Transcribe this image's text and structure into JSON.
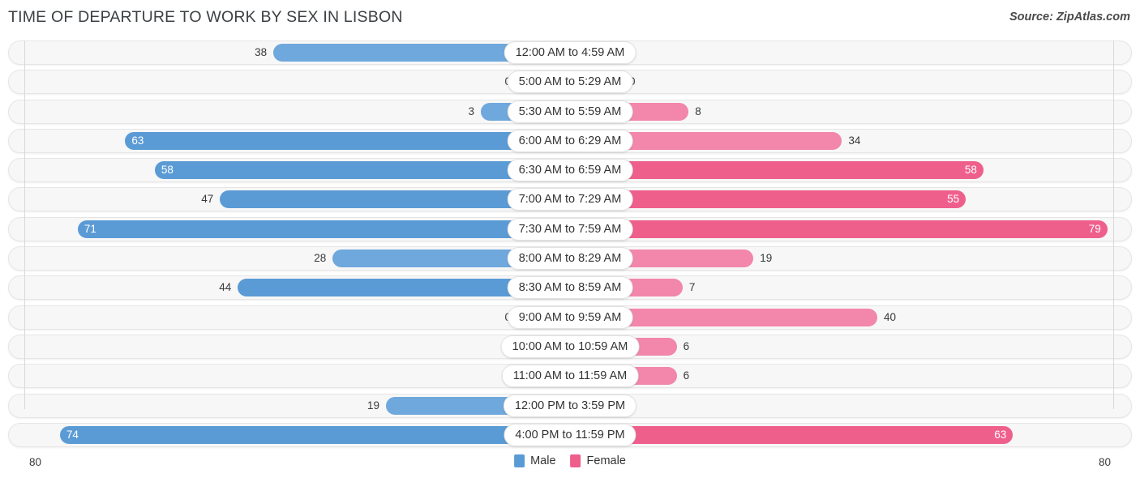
{
  "header": {
    "title": "TIME OF DEPARTURE TO WORK BY SEX IN LISBON",
    "source": "Source: ZipAtlas.com"
  },
  "legend": {
    "male_label": "Male",
    "female_label": "Female",
    "male_color": "#5b9bd5",
    "female_color": "#ef5f8c"
  },
  "axis": {
    "left_max": "80",
    "right_max": "80",
    "max_value": 80
  },
  "chart_data": {
    "type": "bar",
    "title": "TIME OF DEPARTURE TO WORK BY SEX IN LISBON",
    "subtitle": "Source: ZipAtlas.com",
    "orientation": "horizontal-diverging",
    "xlabel": "",
    "ylabel": "",
    "xlim": [
      80,
      80
    ],
    "grid": false,
    "legend_position": "bottom-center",
    "categories": [
      "12:00 AM to 4:59 AM",
      "5:00 AM to 5:29 AM",
      "5:30 AM to 5:59 AM",
      "6:00 AM to 6:29 AM",
      "6:30 AM to 6:59 AM",
      "7:00 AM to 7:29 AM",
      "7:30 AM to 7:59 AM",
      "8:00 AM to 8:29 AM",
      "8:30 AM to 8:59 AM",
      "9:00 AM to 9:59 AM",
      "10:00 AM to 10:59 AM",
      "11:00 AM to 11:59 AM",
      "12:00 PM to 3:59 PM",
      "4:00 PM to 11:59 PM"
    ],
    "series": [
      {
        "name": "Male",
        "color": "#5b9bd5",
        "values": [
          38,
          0,
          3,
          63,
          58,
          47,
          71,
          28,
          44,
          0,
          0,
          0,
          19,
          74
        ]
      },
      {
        "name": "Female",
        "color": "#ef5f8c",
        "values": [
          0,
          0,
          8,
          34,
          58,
          55,
          79,
          19,
          7,
          40,
          6,
          6,
          0,
          63
        ]
      }
    ]
  }
}
